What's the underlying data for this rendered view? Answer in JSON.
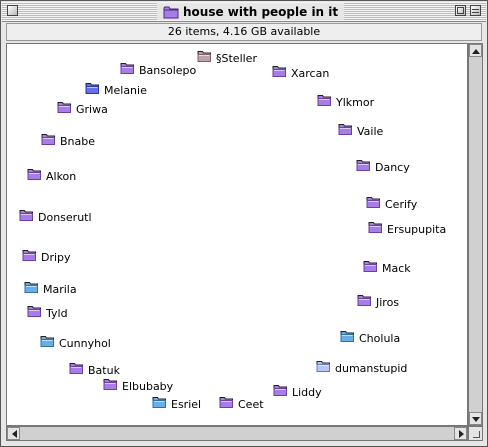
{
  "window": {
    "title": "house with people in it",
    "info": "26 items, 4.16 GB available"
  },
  "colors": {
    "purple": "#a77ee6",
    "purple_dark": "#6a3fa8",
    "blue": "#6aaee8",
    "blue_dark": "#2f6fb0",
    "indigo": "#6670ee",
    "indigo_dark": "#2a35b0",
    "lightblue": "#b8c8f4",
    "lightblue_dark": "#6678b8",
    "grayrose": "#c0a2ac",
    "grayrose_dark": "#7e6070"
  },
  "items": [
    {
      "label": "§Steller",
      "color": "grayrose"
    },
    {
      "label": "Bansolepo",
      "color": "purple"
    },
    {
      "label": "Xarcan",
      "color": "purple"
    },
    {
      "label": "Melanie",
      "color": "indigo"
    },
    {
      "label": "Griwa",
      "color": "purple"
    },
    {
      "label": "Ylkmor",
      "color": "purple"
    },
    {
      "label": "Vaile",
      "color": "purple"
    },
    {
      "label": "Bnabe",
      "color": "purple"
    },
    {
      "label": "Dancy",
      "color": "purple"
    },
    {
      "label": "Alkon",
      "color": "purple"
    },
    {
      "label": "Cerify",
      "color": "purple"
    },
    {
      "label": "Donserutl",
      "color": "purple"
    },
    {
      "label": "Ersupupita",
      "color": "purple"
    },
    {
      "label": "Dripy",
      "color": "purple"
    },
    {
      "label": "Mack",
      "color": "purple"
    },
    {
      "label": "Marila",
      "color": "blue"
    },
    {
      "label": "Jiros",
      "color": "purple"
    },
    {
      "label": "Tyld",
      "color": "purple"
    },
    {
      "label": "Cholula",
      "color": "blue"
    },
    {
      "label": "Cunnyhol",
      "color": "blue"
    },
    {
      "label": "dumanstupid",
      "color": "lightblue"
    },
    {
      "label": "Batuk",
      "color": "purple"
    },
    {
      "label": "Elbubaby",
      "color": "purple"
    },
    {
      "label": "Liddy",
      "color": "purple"
    },
    {
      "label": "Esriel",
      "color": "blue"
    },
    {
      "label": "Ceet",
      "color": "purple"
    }
  ]
}
